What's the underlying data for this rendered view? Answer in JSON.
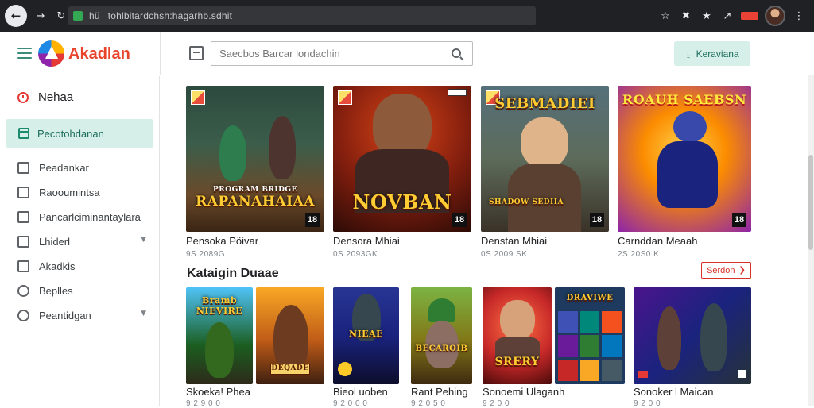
{
  "browser": {
    "url": "tohlbitardchsh:hagarhb.sdhit",
    "url_prefix": "hü"
  },
  "header": {
    "app_name": "Akadlan",
    "search_placeholder": "Saecbos Barcar londachin",
    "cta_label": "Keraviana"
  },
  "sidebar": {
    "heading": "Nehaa",
    "active_item": "Pecotohdanan",
    "items": [
      {
        "label": "Peadankar"
      },
      {
        "label": "Raooumintsa"
      },
      {
        "label": "Pancarlciminantaylara"
      },
      {
        "label": "Lhiderl"
      },
      {
        "label": "Akadkis"
      },
      {
        "label": "Beplles"
      },
      {
        "label": "Peantidgan"
      }
    ]
  },
  "featured": [
    {
      "art_title": "RAPANAHAIAA",
      "art_subtitle": "PROGRAM BRIDGE",
      "title": "Pensoka Pöivar",
      "meta": "9S 2089G",
      "rating": "18"
    },
    {
      "art_title": "NOVBAN",
      "art_subtitle": "",
      "title": "Densora Mhiai",
      "meta": "0S 2093GK",
      "rating": "18"
    },
    {
      "art_title": "SEBMADIEI",
      "art_subtitle": "SHADOW SEDIIA",
      "title": "Denstan Mhiai",
      "meta": "0S 2009 SK",
      "rating": "18"
    },
    {
      "art_title": "ROAUH SAEBSN",
      "art_subtitle": "",
      "title": "Carnddan Meaah",
      "meta": "2S 20S0 K",
      "rating": "18"
    }
  ],
  "section": {
    "title": "Kataigin Duaae",
    "see_all_label": "Serdon"
  },
  "games": [
    {
      "art_title": "Bramb NIEVIRE",
      "title": "Skoeka! Phea",
      "meta": "9 2 9 0 0"
    },
    {
      "art_title": "DEQADE",
      "title": "",
      "meta": ""
    },
    {
      "art_title": "NIEAE",
      "title": "Bieol uoben",
      "meta": "9 2 0 0 0"
    },
    {
      "art_title": "BECAROIB",
      "title": "Rant Pehing",
      "meta": "9 2 0 5 0"
    },
    {
      "art_title": "SRERY",
      "title": "Sonoemi Ulaganh",
      "meta": "9 2 0 0"
    },
    {
      "art_title": "DRAVIWE",
      "title": "",
      "meta": ""
    },
    {
      "art_title": "",
      "title": "Sonoker l Maican",
      "meta": "9 2 0 0"
    }
  ]
}
